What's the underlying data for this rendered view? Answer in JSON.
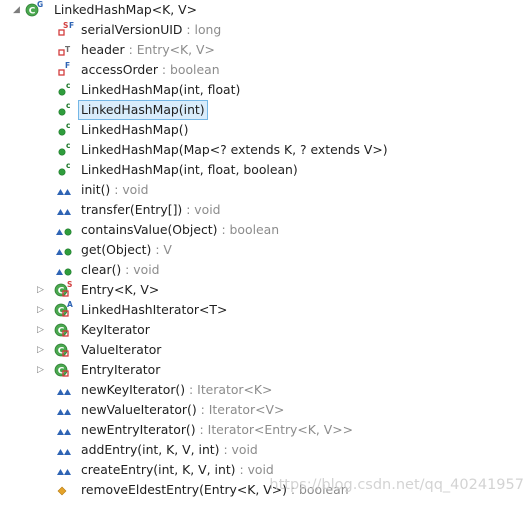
{
  "rows": [
    {
      "name": "LinkedHashMap<K, V>",
      "type": "",
      "icon": "class",
      "twisty": "expanded",
      "depth": 0
    },
    {
      "name": "serialVersionUID",
      "type": " : long",
      "icon": "field-private-static-final",
      "twisty": "",
      "depth": 1
    },
    {
      "name": "header",
      "type": " : Entry<K, V>",
      "icon": "field-private-transient",
      "twisty": "",
      "depth": 1
    },
    {
      "name": "accessOrder",
      "type": " : boolean",
      "icon": "field-private-final",
      "twisty": "",
      "depth": 1
    },
    {
      "name": "LinkedHashMap(int, float)",
      "type": "",
      "icon": "constructor-public",
      "twisty": "",
      "depth": 1
    },
    {
      "name": "LinkedHashMap(int)",
      "type": "",
      "icon": "constructor-public",
      "twisty": "",
      "depth": 1,
      "selected": true
    },
    {
      "name": "LinkedHashMap()",
      "type": "",
      "icon": "constructor-public",
      "twisty": "",
      "depth": 1
    },
    {
      "name": "LinkedHashMap(Map<? extends K, ? extends V>)",
      "type": "",
      "icon": "constructor-public",
      "twisty": "",
      "depth": 1
    },
    {
      "name": "LinkedHashMap(int, float, boolean)",
      "type": "",
      "icon": "constructor-public",
      "twisty": "",
      "depth": 1
    },
    {
      "name": "init()",
      "type": " : void",
      "icon": "method-override",
      "twisty": "",
      "depth": 1
    },
    {
      "name": "transfer(Entry[])",
      "type": " : void",
      "icon": "method-override",
      "twisty": "",
      "depth": 1
    },
    {
      "name": "containsValue(Object)",
      "type": " : boolean",
      "icon": "method-public-override",
      "twisty": "",
      "depth": 1
    },
    {
      "name": "get(Object)",
      "type": " : V",
      "icon": "method-public-override",
      "twisty": "",
      "depth": 1
    },
    {
      "name": "clear()",
      "type": " : void",
      "icon": "method-public-override",
      "twisty": "",
      "depth": 1
    },
    {
      "name": "Entry<K, V>",
      "type": "",
      "icon": "inner-class-private-static",
      "twisty": "collapsed",
      "depth": 1
    },
    {
      "name": "LinkedHashIterator<T>",
      "type": "",
      "icon": "inner-class-private-abstract",
      "twisty": "collapsed",
      "depth": 1
    },
    {
      "name": "KeyIterator",
      "type": "",
      "icon": "inner-class-private",
      "twisty": "collapsed",
      "depth": 1
    },
    {
      "name": "ValueIterator",
      "type": "",
      "icon": "inner-class-private",
      "twisty": "collapsed",
      "depth": 1
    },
    {
      "name": "EntryIterator",
      "type": "",
      "icon": "inner-class-private",
      "twisty": "collapsed",
      "depth": 1
    },
    {
      "name": "newKeyIterator()",
      "type": " : Iterator<K>",
      "icon": "method-override",
      "twisty": "",
      "depth": 1
    },
    {
      "name": "newValueIterator()",
      "type": " : Iterator<V>",
      "icon": "method-override",
      "twisty": "",
      "depth": 1
    },
    {
      "name": "newEntryIterator()",
      "type": " : Iterator<Entry<K, V>>",
      "icon": "method-override",
      "twisty": "",
      "depth": 1
    },
    {
      "name": "addEntry(int, K, V, int)",
      "type": " : void",
      "icon": "method-override",
      "twisty": "",
      "depth": 1
    },
    {
      "name": "createEntry(int, K, V, int)",
      "type": " : void",
      "icon": "method-override",
      "twisty": "",
      "depth": 1
    },
    {
      "name": "removeEldestEntry(Entry<K, V>)",
      "type": " : boolean",
      "icon": "method-protected",
      "twisty": "",
      "depth": 1
    }
  ],
  "watermark": "https://blog.csdn.net/qq_40241957",
  "colors": {
    "public": "#2f9d3c",
    "private": "#d23c3c",
    "protected": "#e5a32a",
    "override": "#2f64b4",
    "selection_bg": "#d9ecfb",
    "selection_border": "#75b7e6",
    "type_text": "#8c8c8c"
  }
}
